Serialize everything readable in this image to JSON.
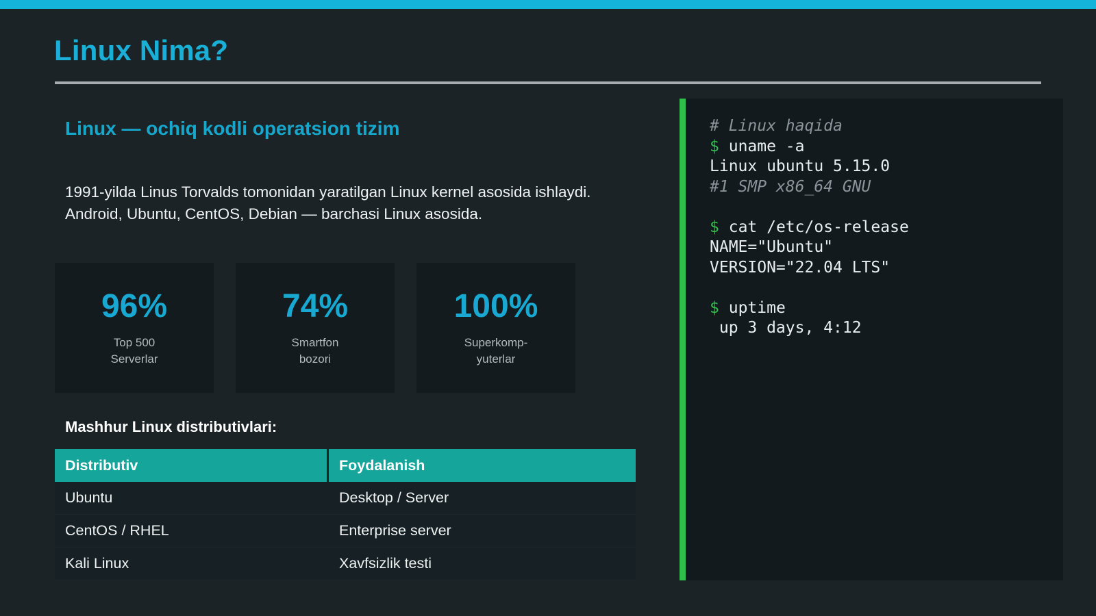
{
  "title": "Linux Nima?",
  "subtitle": "Linux — ochiq kodli operatsion tizim",
  "intro": "1991-yilda Linus Torvalds tomonidan yaratilgan Linux kernel asosida ishlaydi. Android, Ubuntu, CentOS, Debian — barchasi Linux asosida.",
  "stats": [
    {
      "value": "96%",
      "label": "Top 500\nServerlar"
    },
    {
      "value": "74%",
      "label": "Smartfon\nbozori"
    },
    {
      "value": "100%",
      "label": "Superkomp-\nyuterlar"
    }
  ],
  "table": {
    "heading": "Mashhur Linux distributivlari:",
    "headers": [
      "Distributiv",
      "Foydalanish"
    ],
    "rows": [
      [
        "Ubuntu",
        "Desktop / Server"
      ],
      [
        "CentOS / RHEL",
        "Enterprise server"
      ],
      [
        "Kali Linux",
        "Xavfsizlik testi"
      ]
    ]
  },
  "terminal": {
    "prompt_symbol": "$",
    "lines": [
      {
        "kind": "comment",
        "text": "# Linux haqida"
      },
      {
        "kind": "command",
        "text": "uname -a"
      },
      {
        "kind": "output",
        "text": "Linux ubuntu 5.15.0"
      },
      {
        "kind": "meta",
        "text": "#1 SMP x86_64 GNU"
      },
      {
        "kind": "blank",
        "text": ""
      },
      {
        "kind": "command",
        "text": "cat /etc/os-release"
      },
      {
        "kind": "output",
        "text": "NAME=\"Ubuntu\""
      },
      {
        "kind": "output",
        "text": "VERSION=\"22.04 LTS\""
      },
      {
        "kind": "blank",
        "text": ""
      },
      {
        "kind": "command",
        "text": "uptime"
      },
      {
        "kind": "output",
        "text": " up 3 days, 4:12"
      }
    ]
  },
  "colors": {
    "accent": "#14b4da",
    "table_header": "#16a59a",
    "terminal_accent": "#2fc04c",
    "background": "#1b2327"
  }
}
